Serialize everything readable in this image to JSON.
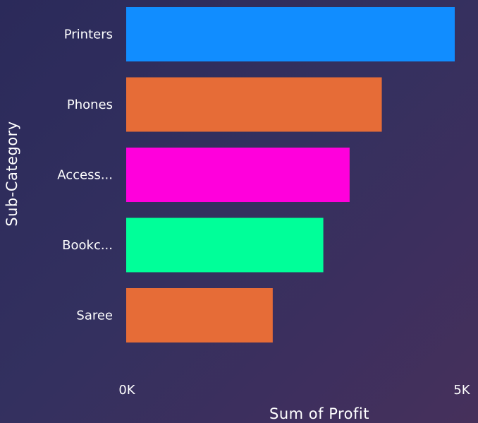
{
  "chart_data": {
    "type": "bar",
    "orientation": "horizontal",
    "categories": [
      "Printers",
      "Phones",
      "Access...",
      "Bookc...",
      "Saree"
    ],
    "values": [
      5000,
      3890,
      3400,
      3000,
      2230
    ],
    "colors": [
      "#118dff",
      "#e66c37",
      "#ff00dc",
      "#00ff99",
      "#e66c37"
    ],
    "xlabel": "Sum of Profit",
    "ylabel": "Sub-Category",
    "xlim": [
      0,
      5000
    ],
    "x_ticks": [
      "0K",
      "5K"
    ],
    "grid": false,
    "legend": "none"
  }
}
